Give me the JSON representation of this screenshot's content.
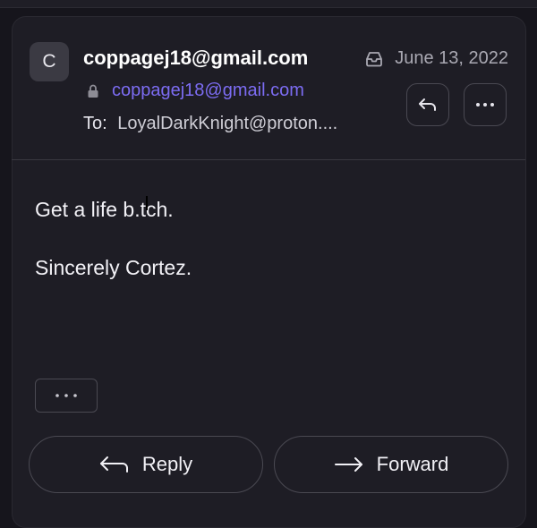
{
  "message": {
    "avatar_initial": "C",
    "sender_name": "coppagej18@gmail.com",
    "sender_email": "coppagej18@gmail.com",
    "to_label": "To:",
    "to_value": "LoyalDarkKnight@proton....",
    "date": "June 13, 2022",
    "body_lines": [
      "Get a life b.tch.",
      "Sincerely Cortez."
    ]
  },
  "actions": {
    "reply_label": "Reply",
    "forward_label": "Forward"
  },
  "icons": {
    "lock": "lock-icon",
    "inbox": "inbox-icon",
    "reply": "reply-arrow-icon",
    "more": "more-horizontal-icon",
    "forward": "forward-arrow-icon"
  },
  "colors": {
    "background": "#16151c",
    "card": "#1e1d25",
    "accent": "#7c6cf2",
    "text": "#f2f1f6",
    "muted": "#a9a8b2",
    "border": "#4a4952"
  }
}
